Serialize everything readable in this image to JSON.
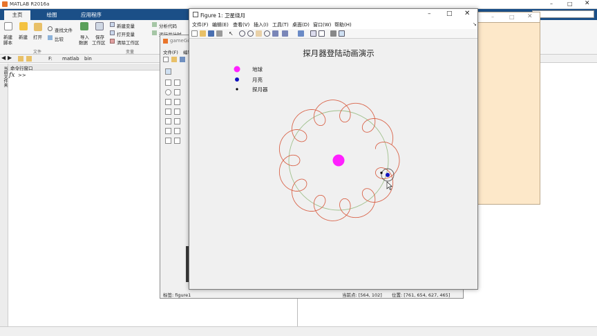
{
  "matlab": {
    "title": "MATLAB R2016a",
    "tabs": [
      "主页",
      "绘图",
      "应用程序"
    ],
    "ribbon": {
      "new_script": [
        "新建",
        "脚本"
      ],
      "new": "新建",
      "open": "打开",
      "find_files": "查找文件",
      "compare": "比较",
      "import": [
        "导入",
        "数据"
      ],
      "save_ws": [
        "保存",
        "工作区"
      ],
      "new_var": "新建变量",
      "open_var": "打开变量",
      "clear_ws": "清除工作区",
      "analyze": "分析代码",
      "run_time": "运行并计时",
      "section_file": "文件",
      "section_var": "变量"
    },
    "address": {
      "drive": "F:",
      "p1": "matlab",
      "p2": "bin"
    },
    "cmd_header": "命令行窗口",
    "prompt": ">>",
    "fx": "fx",
    "sidebar_label": "当前文件夹"
  },
  "guide": {
    "title": "gameGu",
    "menu": [
      "文件(F)",
      "编辑"
    ],
    "status_tag": "标签: figure1",
    "status_point": "当前点: [564, 102]",
    "status_pos": "位置: [761, 654, 627, 465]"
  },
  "figure": {
    "title": "Figure 1: 卫星绕月",
    "menus": [
      "文件(F)",
      "编辑(E)",
      "查看(V)",
      "插入(I)",
      "工具(T)",
      "桌面(D)",
      "窗口(W)",
      "帮助(H)"
    ],
    "plot_title": "探月器登陆动画演示",
    "legend": [
      {
        "label": "地球",
        "color": "#ff20ff"
      },
      {
        "label": "月亮",
        "color": "#1010c0"
      },
      {
        "label": "探月器",
        "color": "#000000"
      }
    ]
  },
  "colors": {
    "ribbon_tab_bg": "#1b4f87",
    "earth": "#ff20ff",
    "moon": "#1010c0",
    "probe_path": "#d9644a",
    "moon_orbit": "#9fc08c",
    "peach": "#fde8c9"
  }
}
